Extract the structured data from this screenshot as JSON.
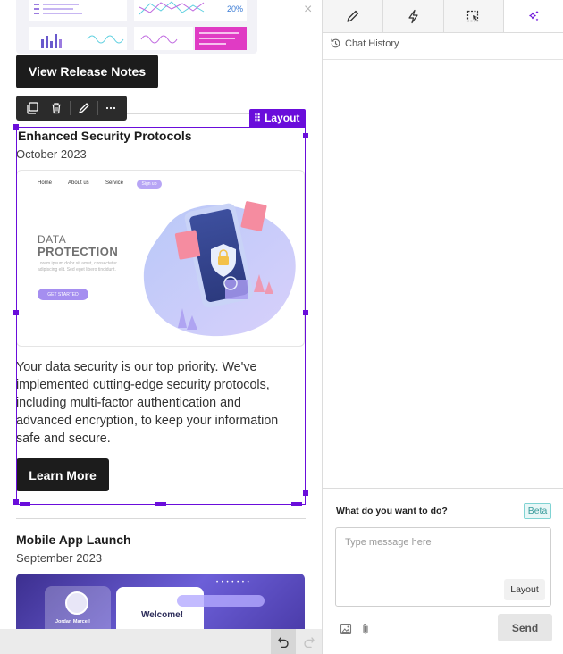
{
  "canvas": {
    "release_button": "View Release Notes",
    "toolbar": {
      "items": [
        "copy-icon",
        "trash-icon",
        "pencil-icon",
        "more-icon"
      ]
    },
    "layout_tag": "Layout",
    "cards": [
      {
        "title": "Enhanced Security Protocols",
        "date": "October 2023",
        "image": {
          "nav": [
            "Home",
            "About us",
            "Service"
          ],
          "signup": "Sign up",
          "headline_1": "DATA",
          "headline_2": "PROTECTION",
          "lorem": "Lorem ipsum dolor sit amet, consectetur adipiscing elit. Sed eget libero tincidunt.",
          "cta": "GET STARTED"
        },
        "body": "Your data security is our top priority. We've implemented cutting-edge security protocols, including multi-factor authentication and advanced encryption, to keep your information safe and secure.",
        "button": "Learn More"
      },
      {
        "title": "Mobile App Launch",
        "date": "September 2023",
        "image": {
          "profile_name": "Jordan Marcell",
          "welcome": "Welcome!"
        }
      }
    ]
  },
  "panel": {
    "tabs": [
      "pencil-icon",
      "bolt-icon",
      "select-icon",
      "sparkle-icon"
    ],
    "chat_history": "Chat History",
    "composer": {
      "label": "What do you want to do?",
      "badge": "Beta",
      "placeholder": "Type message here",
      "mode": "Layout",
      "send": "Send"
    }
  },
  "colors": {
    "accent": "#6a0ddb",
    "button_dark": "#1c1c1c",
    "beta": "#3a9c9c"
  }
}
